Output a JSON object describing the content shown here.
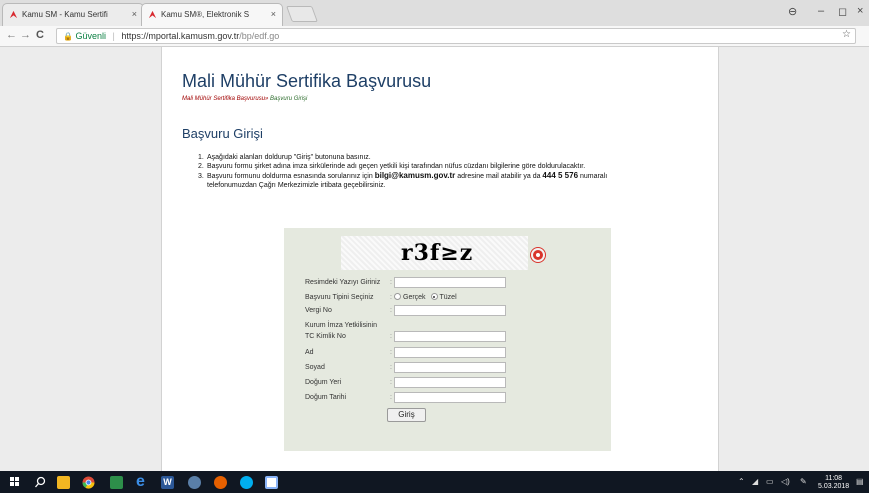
{
  "browser": {
    "tabs": [
      {
        "title": "Kamu SM - Kamu Sertifi",
        "active": false
      },
      {
        "title": "Kamu SM®, Elektronik S",
        "active": true
      }
    ],
    "address": {
      "secure_label": "Güvenli",
      "separator": "|",
      "url_host": "https://mportal.kamusm.gov.tr",
      "url_path": "/bp/edf.go"
    },
    "nav": {
      "back": "←",
      "forward": "→",
      "reload": "C"
    },
    "window": {
      "profile": "⊖",
      "minimize": "–",
      "maximize": "◻",
      "close": "×"
    },
    "star": "☆",
    "tab_close": "×"
  },
  "page": {
    "title": "Mali Mühür Sertifika Başvurusu",
    "breadcrumb": {
      "item1": "Mali Mühür Sertifika Başvurusu",
      "sep": "»",
      "item2": "Başvuru Girişi"
    },
    "section_title": "Başvuru Girişi",
    "instructions": {
      "n1": "1.",
      "i1": "Aşağıdaki alanları doldurup \"Giriş\" butonuna basınız.",
      "n2": "2.",
      "i2": "Başvuru formu şirket adına imza sirkülerinde adı geçen yetkili kişi tarafından nüfus cüzdanı bilgilerine göre doldurulacaktır.",
      "n3": "3.",
      "i3_a": "Başvuru formunu doldurma esnasında sorularınız için ",
      "i3_email": "bilgi@kamusm.gov.tr",
      "i3_b": " adresine mail atabilir ya da ",
      "i3_phone": "444 5 576",
      "i3_c": " numaralı",
      "i3_d": "telefonumuzdan Çağrı Merkezimizle irtibata geçebilirsiniz."
    },
    "form": {
      "captcha_text": "r3f≥z",
      "colon": ":",
      "captcha_label": "Resimdeki Yazıyı Giriniz",
      "type_label": "Başvuru Tipini Seçiniz",
      "type_options": [
        "Gerçek",
        "Tüzel"
      ],
      "type_selected": "Tüzel",
      "tax_label": "Vergi No",
      "subheading": "Kurum İmza Yetkilisinin",
      "tc_label": "TC Kimlik No",
      "name_label": "Ad",
      "surname_label": "Soyad",
      "birthplace_label": "Doğum Yeri",
      "birthdate_label": "Doğum Tarihi",
      "submit_label": "Giriş"
    }
  },
  "taskbar": {
    "time": "11:08",
    "date": "5.03.2018",
    "icons": [
      "windows-icon",
      "search-icon",
      "file-explorer-icon",
      "chrome-icon",
      "photo-icon",
      "edge-icon",
      "word-icon",
      "app-icon",
      "firefox-icon",
      "skype-icon",
      "image-icon"
    ]
  }
}
